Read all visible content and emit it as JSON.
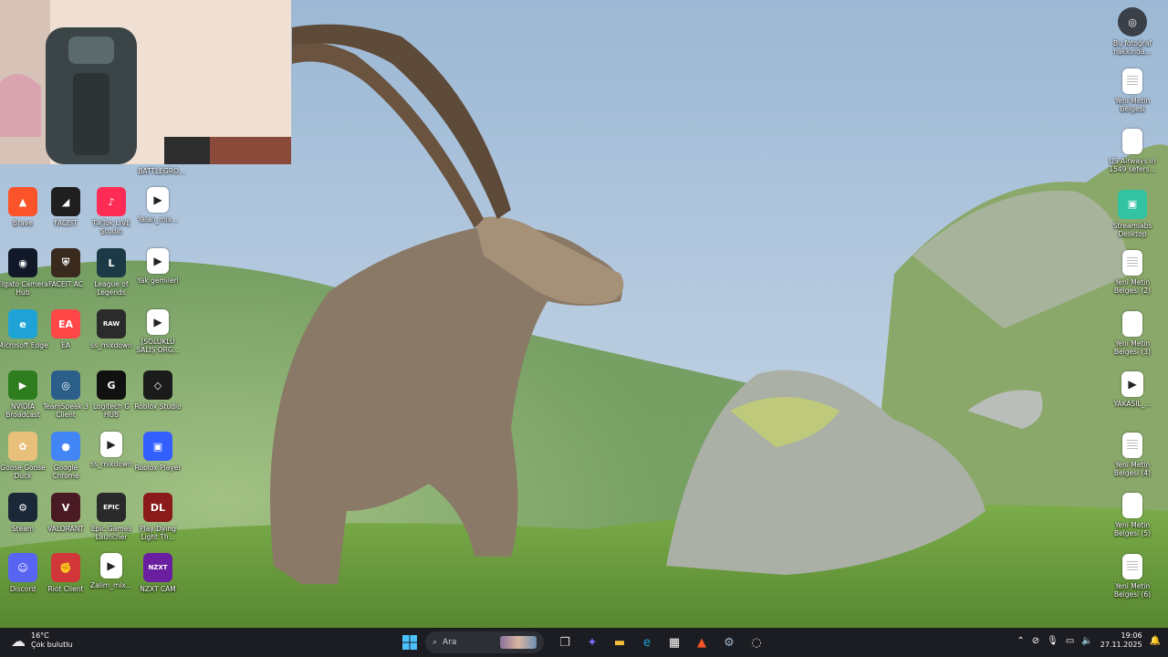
{
  "desktop": {
    "left_icons": [
      {
        "label": "BATTLEGRO...",
        "icon": "battlegrounds-icon",
        "glyph": "",
        "bg": "#333333"
      },
      {
        "label": "Brave",
        "icon": "brave-icon",
        "glyph": "▲",
        "bg": "#fb542b"
      },
      {
        "label": "FACEIT",
        "icon": "faceit-icon",
        "glyph": "◢",
        "bg": "#1f1f1f"
      },
      {
        "label": "TikTok LIVE Studio",
        "icon": "tiktok-live-icon",
        "glyph": "♪",
        "bg": "#fe2c55"
      },
      {
        "label": "Yalan_mix...",
        "icon": "video-file-icon",
        "glyph": "▶",
        "bg": "#ffffff"
      },
      {
        "label": "Elgato Camera Hub",
        "icon": "elgato-icon",
        "glyph": "◉",
        "bg": "#111827"
      },
      {
        "label": "FACEIT AC",
        "icon": "faceit-ac-icon",
        "glyph": "⛨",
        "bg": "#3a2a1e"
      },
      {
        "label": "League of Legends",
        "icon": "league-icon",
        "glyph": "L",
        "bg": "#1c3a46"
      },
      {
        "label": "Yak gemileri",
        "icon": "video-file-icon",
        "glyph": "▶",
        "bg": "#ffffff"
      },
      {
        "label": "Microsoft Edge",
        "icon": "edge-icon",
        "glyph": "e",
        "bg": "#1fa3d6"
      },
      {
        "label": "EA",
        "icon": "ea-icon",
        "glyph": "EA",
        "bg": "#ff4747"
      },
      {
        "label": "ss_mixdown",
        "icon": "raw-audio-icon",
        "glyph": "RAW",
        "bg": "#2b2b2b"
      },
      {
        "label": "[SOLUKLU SALIŞ ORG...",
        "icon": "video-file-icon",
        "glyph": "▶",
        "bg": "#ffffff"
      },
      {
        "label": "NVIDIA Broadcast",
        "icon": "nvidia-icon",
        "glyph": "▶",
        "bg": "#2d7d1f"
      },
      {
        "label": "TeamSpeak 3 Client",
        "icon": "teamspeak-icon",
        "glyph": "◎",
        "bg": "#2c5e8a"
      },
      {
        "label": "Logitech G HUB",
        "icon": "logitech-icon",
        "glyph": "G",
        "bg": "#111111"
      },
      {
        "label": "Roblox Studio",
        "icon": "roblox-studio-icon",
        "glyph": "◇",
        "bg": "#1b1b1b"
      },
      {
        "label": "Goose Goose Duck",
        "icon": "goose-icon",
        "glyph": "✿",
        "bg": "#e8c07a"
      },
      {
        "label": "Google Chrome",
        "icon": "chrome-icon",
        "glyph": "●",
        "bg": "#4285f4"
      },
      {
        "label": "ss_mixdown",
        "icon": "video-file-icon",
        "glyph": "▶",
        "bg": "#ffffff"
      },
      {
        "label": "Roblox Player",
        "icon": "roblox-player-icon",
        "glyph": "▣",
        "bg": "#335fff"
      },
      {
        "label": "Steam",
        "icon": "steam-icon",
        "glyph": "⚙",
        "bg": "#1b2838"
      },
      {
        "label": "VALORANT",
        "icon": "valorant-icon",
        "glyph": "V",
        "bg": "#4a1a24"
      },
      {
        "label": "Epic Games Launcher",
        "icon": "epic-icon",
        "glyph": "EPIC",
        "bg": "#2a2a2a"
      },
      {
        "label": "Play Dying Light Th...",
        "icon": "dying-light-icon",
        "glyph": "DL",
        "bg": "#8b1a1a"
      },
      {
        "label": "Discord",
        "icon": "discord-icon",
        "glyph": "☺",
        "bg": "#5865f2"
      },
      {
        "label": "Riot Client",
        "icon": "riot-icon",
        "glyph": "✊",
        "bg": "#d13639"
      },
      {
        "label": "Zalim_mix...",
        "icon": "video-file-icon",
        "glyph": "▶",
        "bg": "#ffffff"
      },
      {
        "label": "NZXT CAM",
        "icon": "nzxt-icon",
        "glyph": "NZXT",
        "bg": "#6a1fa0"
      }
    ],
    "right_icons": [
      {
        "label": "Bu fotoğraf hakkında...",
        "icon": "camera-info-icon",
        "glyph": "◎",
        "type": "app"
      },
      {
        "label": "Yeni Metin Belgesi",
        "icon": "text-document-icon",
        "type": "doc"
      },
      {
        "label": "US Airways ın 1549 sefers...",
        "icon": "blank-document-icon",
        "type": "doc"
      },
      {
        "label": "Streamlabs Desktop",
        "icon": "streamlabs-icon",
        "glyph": "▣",
        "type": "app"
      },
      {
        "label": "Yeni Metin Belgesi (2)",
        "icon": "text-document-icon",
        "type": "doc"
      },
      {
        "label": "Yeni Metin Belgesi (3)",
        "icon": "blank-document-icon",
        "type": "doc"
      },
      {
        "label": "YAKASIL_...",
        "icon": "video-file-icon",
        "type": "vid"
      },
      {
        "label": "Yeni Metin Belgesi (4)",
        "icon": "text-document-icon",
        "type": "doc"
      },
      {
        "label": "Yeni Metin Belgesi (5)",
        "icon": "blank-document-icon",
        "type": "doc"
      },
      {
        "label": "Yeni Metin Belgesi (6)",
        "icon": "text-document-icon",
        "type": "doc"
      }
    ]
  },
  "taskbar": {
    "weather_temp": "16°C",
    "weather_desc": "Çok bulutlu",
    "search_placeholder": "Ara",
    "pinned": [
      {
        "name": "task-view-icon",
        "glyph": "❐",
        "color": "#cfd0d4"
      },
      {
        "name": "copilot-icon",
        "glyph": "✦",
        "color": "#7b6cff"
      },
      {
        "name": "file-explorer-icon",
        "glyph": "▬",
        "color": "#f3c13a"
      },
      {
        "name": "edge-taskbar-icon",
        "glyph": "e",
        "color": "#1fa3d6"
      },
      {
        "name": "store-icon",
        "glyph": "▦",
        "color": "#ffffff"
      },
      {
        "name": "brave-taskbar-icon",
        "glyph": "▲",
        "color": "#fb542b"
      },
      {
        "name": "steam-taskbar-icon",
        "glyph": "⚙",
        "color": "#9fb6c8"
      },
      {
        "name": "recorder-taskbar-icon",
        "glyph": "◌",
        "color": "#e0e0e0"
      }
    ],
    "time": "19:06",
    "date": "27.11.2025"
  }
}
